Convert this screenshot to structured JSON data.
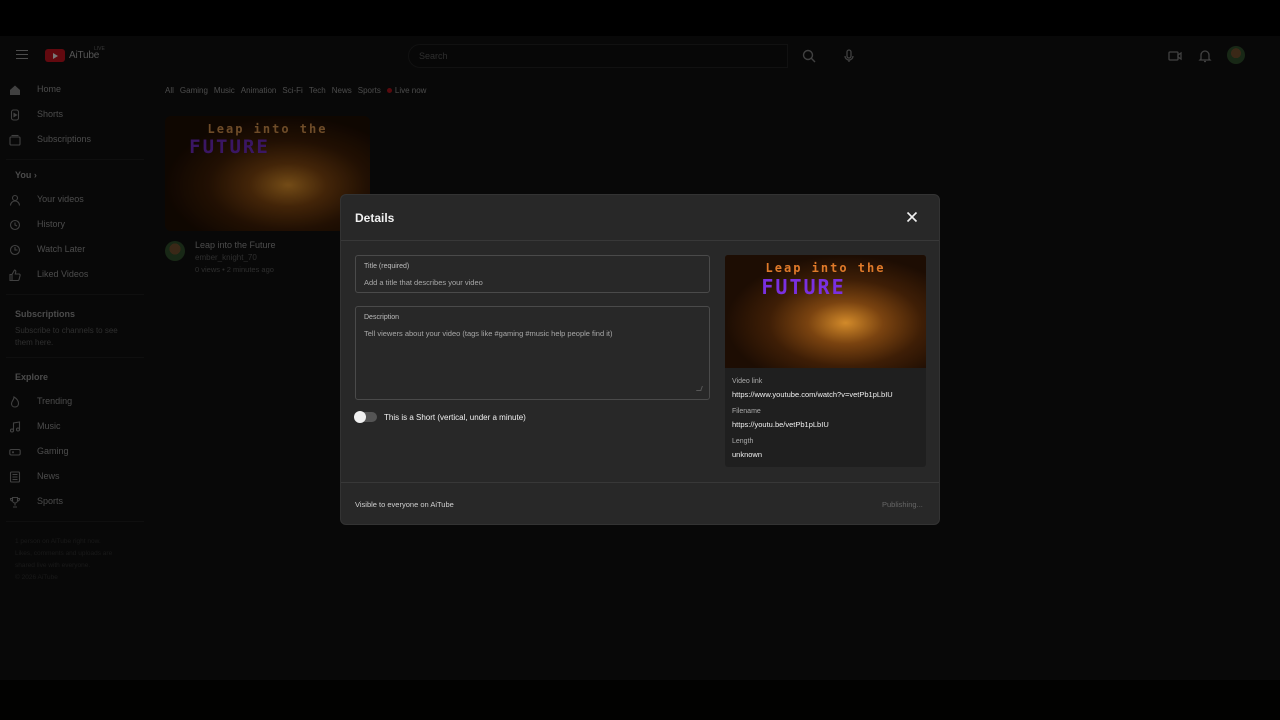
{
  "app": {
    "brand": "AiTube",
    "live_badge": "LIVE",
    "search_placeholder": "Search"
  },
  "sidebar": {
    "main": [
      {
        "label": "Home",
        "icon": "home-icon"
      },
      {
        "label": "Shorts",
        "icon": "shorts-icon"
      },
      {
        "label": "Subscriptions",
        "icon": "subscriptions-icon"
      }
    ],
    "you_heading": "You ›",
    "you_items": [
      {
        "label": "Your videos",
        "icon": "person-icon"
      },
      {
        "label": "History",
        "icon": "history-icon"
      },
      {
        "label": "Watch Later",
        "icon": "clock-icon"
      },
      {
        "label": "Liked Videos",
        "icon": "thumbs-up-icon"
      }
    ],
    "subscriptions_heading": "Subscriptions",
    "subscriptions_note": "Subscribe to channels to see them here.",
    "explore_heading": "Explore",
    "explore_items": [
      {
        "label": "Trending",
        "icon": "flame-icon"
      },
      {
        "label": "Music",
        "icon": "music-note-icon"
      },
      {
        "label": "Gaming",
        "icon": "gamepad-icon"
      },
      {
        "label": "News",
        "icon": "newspaper-icon"
      },
      {
        "label": "Sports",
        "icon": "trophy-icon"
      }
    ],
    "footer_1": "1 person on AiTube right now.",
    "footer_2": "Likes, comments and uploads are shared live with everyone.",
    "footer_3": "© 2026 AiTube"
  },
  "chips": [
    "All",
    "Gaming",
    "Music",
    "Animation",
    "Sci-Fi",
    "Tech",
    "News",
    "Sports"
  ],
  "live_chip": "Live now",
  "video_card": {
    "thumb_line1": "Leap into the",
    "thumb_line2": "FUTURE",
    "title": "Leap into the Future",
    "channel": "ember_knight_70",
    "stats": "0 views • 2 minutes ago"
  },
  "modal": {
    "title": "Details",
    "title_field_label": "Title (required)",
    "title_field_placeholder": "Add a title that describes your video",
    "description_label": "Description",
    "description_placeholder": "Tell viewers about your video (tags like #gaming #music help people find it)",
    "short_toggle_label": "This is a Short (vertical, under a minute)",
    "short_toggle_on": false,
    "preview": {
      "thumb_line1": "Leap into the",
      "thumb_line2": "FUTURE",
      "video_link_label": "Video link",
      "video_link": "https://www.youtube.com/watch?v=vetPb1pLbIU",
      "filename_label": "Filename",
      "filename": "https://youtu.be/vetPb1pLbIU",
      "length_label": "Length",
      "length": "unknown"
    },
    "visibility_text": "Visible to everyone on AiTube",
    "status_text": "Publishing..."
  },
  "colors": {
    "modal_bg": "#282828",
    "brand_red": "#b3121d",
    "thumb_purple": "#7a30e0",
    "thumb_orange": "#e07a2a"
  }
}
